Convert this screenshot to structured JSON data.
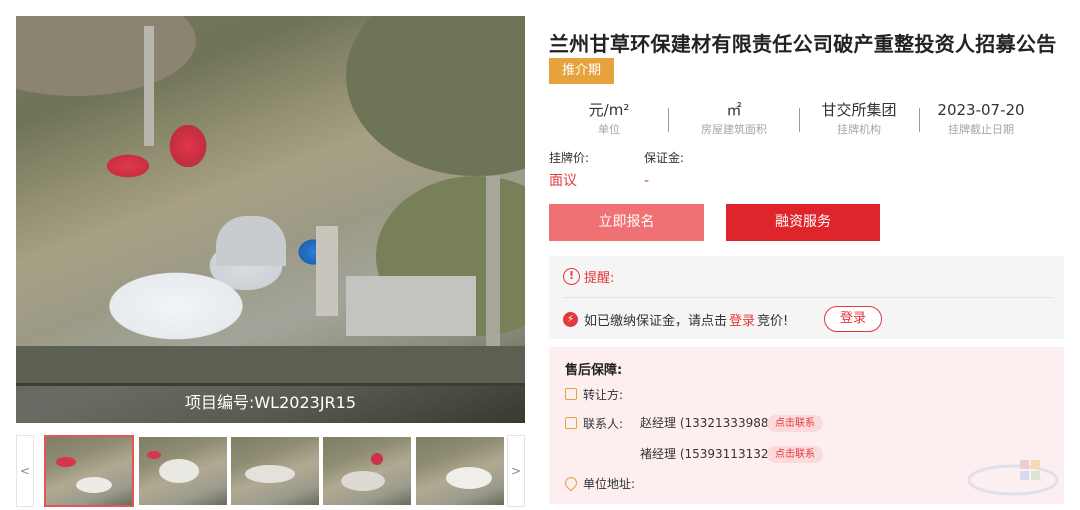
{
  "gallery": {
    "caption": "项目编号:WL2023JR15",
    "prev_label": "<",
    "next_label": ">",
    "thumbnails": [
      {
        "name": "thumbnail-1",
        "active": true
      },
      {
        "name": "thumbnail-2",
        "active": false
      },
      {
        "name": "thumbnail-3",
        "active": false
      },
      {
        "name": "thumbnail-4",
        "active": false
      },
      {
        "name": "thumbnail-5",
        "active": false
      }
    ]
  },
  "listing": {
    "title": "兰州甘草环保建材有限责任公司破产重整投资人招募公告",
    "status": "推介期",
    "stats": [
      {
        "value": "元/m²",
        "label": "单位"
      },
      {
        "value": "㎡",
        "label": "房屋建筑面积"
      },
      {
        "value": "甘交所集团",
        "label": "挂牌机构"
      },
      {
        "value": "2023-07-20",
        "label": "挂牌截止日期"
      }
    ],
    "price_label": "挂牌价:",
    "price_value": "面议",
    "deposit_label": "保证金:",
    "deposit_value": "-"
  },
  "actions": {
    "signup_label": "立即报名",
    "finance_label": "融资服务"
  },
  "notice": {
    "head_label": "提醒:",
    "text_before": "如已缴纳保证金，请点击",
    "link_label": "登录",
    "text_after": "竞价!",
    "login_button": "登录"
  },
  "after_sale": {
    "heading": "售后保障:",
    "transferor_label": "转让方:",
    "contact_label": "联系人:",
    "contacts": [
      {
        "line": "赵经理 (13321333988)",
        "tag": "点击联系"
      },
      {
        "line": "褚经理 (15393113132)",
        "tag": "点击联系"
      }
    ],
    "address_label": "单位地址:"
  },
  "colors": {
    "accent_red": "#e4393c",
    "signup_pink": "#f07173",
    "finance_red": "#e0242b",
    "status_orange": "#e6a23c",
    "after_sale_bg": "#fdeff0"
  }
}
